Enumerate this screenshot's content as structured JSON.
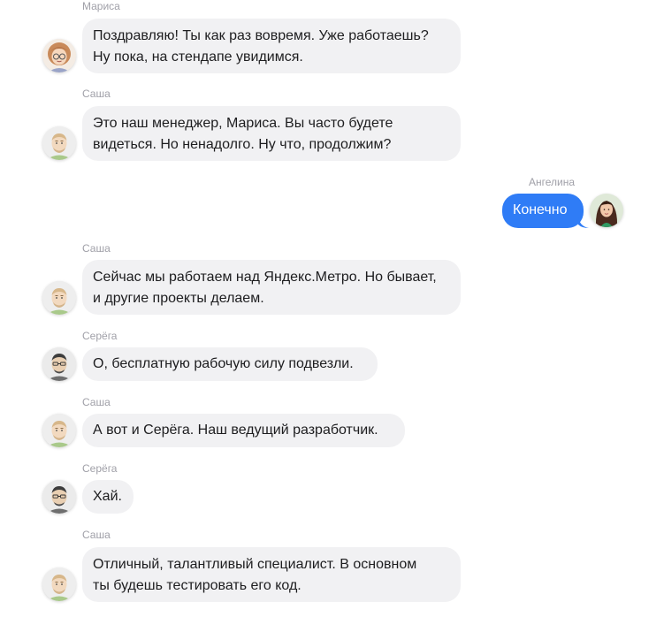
{
  "colors": {
    "incoming_bubble": "#f1f1f3",
    "outgoing_bubble": "#2f7cf6",
    "sender_name": "#a0a0a8",
    "text": "#1d1d1f"
  },
  "messages": [
    {
      "sender": "Мариса",
      "text": "Поздравляю! Ты как раз вовремя. Уже работаешь?\nНу пока, на стендапе увидимся.",
      "avatar": "marisa-avatar",
      "direction": "incoming"
    },
    {
      "sender": "Саша",
      "text": "Это наш менеджер, Мариса. Вы часто будете\nвидеться. Но ненадолго. Ну что, продолжим?",
      "avatar": "sasha-avatar",
      "direction": "incoming"
    },
    {
      "sender": "Ангелина",
      "text": "Конечно",
      "avatar": "angelina-avatar",
      "direction": "outgoing"
    },
    {
      "sender": "Саша",
      "text": "Сейчас мы работаем над Яндекс.Метро. Но бывает,\nи другие проекты делаем.",
      "avatar": "sasha-avatar",
      "direction": "incoming"
    },
    {
      "sender": "Серёга",
      "text": "О, бесплатную рабочую силу подвезли.",
      "avatar": "serega-avatar",
      "direction": "incoming"
    },
    {
      "sender": "Саша",
      "text": "А вот и Серёга. Наш ведущий разработчик.",
      "avatar": "sasha-avatar",
      "direction": "incoming"
    },
    {
      "sender": "Серёга",
      "text": "Хай.",
      "avatar": "serega-avatar",
      "direction": "incoming"
    },
    {
      "sender": "Саша",
      "text": "Отличный, талантливый специалист. В основном\nты будешь тестировать его код.",
      "avatar": "sasha-avatar",
      "direction": "incoming"
    }
  ]
}
